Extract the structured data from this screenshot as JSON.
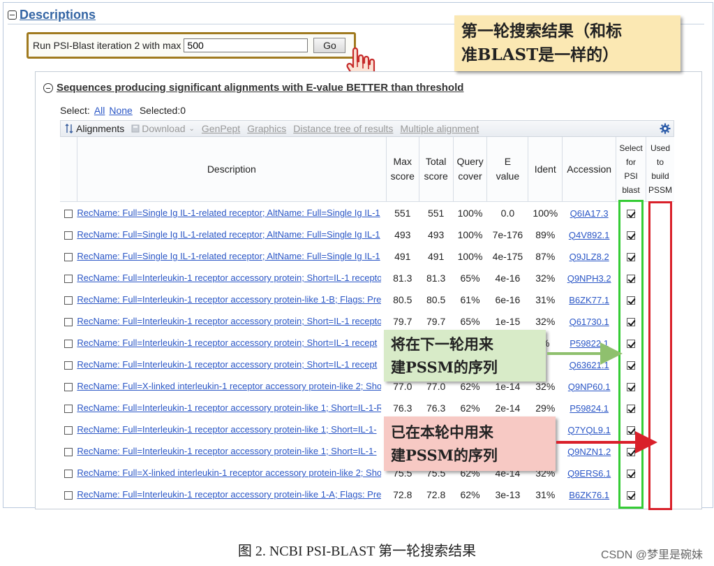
{
  "descriptions": {
    "title": "Descriptions"
  },
  "psi": {
    "label": "Run PSI-Blast iteration 2 with max",
    "value": "500",
    "go_label": "Go"
  },
  "section": {
    "title": "Sequences producing significant alignments with E-value BETTER than threshold"
  },
  "select": {
    "label": "Select:",
    "all": "All",
    "none": "None",
    "selected": "Selected:0"
  },
  "toolbar": {
    "alignments": "Alignments",
    "download": "Download",
    "genpept": "GenPept",
    "graphics": "Graphics",
    "distance_tree": "Distance tree of results",
    "multiple_alignment": "Multiple alignment"
  },
  "table": {
    "headers": {
      "description": "Description",
      "max_score": [
        "Max",
        "score"
      ],
      "total_score": [
        "Total",
        "score"
      ],
      "query_cover": [
        "Query",
        "cover"
      ],
      "e_value": [
        "E",
        "value"
      ],
      "ident": "Ident",
      "accession": "Accession",
      "select_psi": [
        "Select",
        "for",
        "PSI",
        "blast"
      ],
      "used_pssm": [
        "Used",
        "to",
        "build",
        "PSSM"
      ]
    },
    "rows": [
      {
        "desc": "RecName: Full=Single Ig IL-1-related receptor; AltName: Full=Single Ig IL-1",
        "max": "551",
        "total": "551",
        "cover": "100%",
        "e": "0.0",
        "ident": "100%",
        "acc": "Q6IA17.3"
      },
      {
        "desc": "RecName: Full=Single Ig IL-1-related receptor; AltName: Full=Single Ig IL-1",
        "max": "493",
        "total": "493",
        "cover": "100%",
        "e": "7e-176",
        "ident": "89%",
        "acc": "Q4V892.1"
      },
      {
        "desc": "RecName: Full=Single Ig IL-1-related receptor; AltName: Full=Single Ig IL-1",
        "max": "491",
        "total": "491",
        "cover": "100%",
        "e": "4e-175",
        "ident": "87%",
        "acc": "Q9JLZ8.2"
      },
      {
        "desc": "RecName: Full=Interleukin-1 receptor accessory protein; Short=IL-1 recepto",
        "max": "81.3",
        "total": "81.3",
        "cover": "65%",
        "e": "4e-16",
        "ident": "32%",
        "acc": "Q9NPH3.2"
      },
      {
        "desc": "RecName: Full=Interleukin-1 receptor accessory protein-like 1-B; Flags: Pre",
        "max": "80.5",
        "total": "80.5",
        "cover": "61%",
        "e": "6e-16",
        "ident": "31%",
        "acc": "B6ZK77.1"
      },
      {
        "desc": "RecName: Full=Interleukin-1 receptor accessory protein; Short=IL-1 recepto",
        "max": "79.7",
        "total": "79.7",
        "cover": "65%",
        "e": "1e-15",
        "ident": "32%",
        "acc": "Q61730.1"
      },
      {
        "desc": "RecName: Full=Interleukin-1 receptor accessory protein; Short=IL-1 recept",
        "max": "",
        "total": "",
        "cover": "",
        "e": "",
        "ident": "%",
        "acc": "P59822.1"
      },
      {
        "desc": "RecName: Full=Interleukin-1 receptor accessory protein; Short=IL-1 recept",
        "max": "",
        "total": "",
        "cover": "",
        "e": "",
        "ident": "",
        "acc": "Q63621.1"
      },
      {
        "desc": "RecName: Full=X-linked interleukin-1 receptor accessory protein-like 2; Sho",
        "max": "77.0",
        "total": "77.0",
        "cover": "62%",
        "e": "1e-14",
        "ident": "32%",
        "acc": "Q9NP60.1"
      },
      {
        "desc": "RecName: Full=Interleukin-1 receptor accessory protein-like 1; Short=IL-1-R",
        "max": "76.3",
        "total": "76.3",
        "cover": "62%",
        "e": "2e-14",
        "ident": "29%",
        "acc": "P59824.1"
      },
      {
        "desc": "RecName: Full=Interleukin-1 receptor accessory protein-like 1; Short=IL-1-",
        "max": "",
        "total": "",
        "cover": "",
        "e": "",
        "ident": "",
        "acc": "Q7YQL9.1"
      },
      {
        "desc": "RecName: Full=Interleukin-1 receptor accessory protein-like 1; Short=IL-1-",
        "max": "",
        "total": "",
        "cover": "",
        "e": "",
        "ident": "",
        "acc": "Q9NZN1.2"
      },
      {
        "desc": "RecName: Full=X-linked interleukin-1 receptor accessory protein-like 2; Sho",
        "max": "75.5",
        "total": "75.5",
        "cover": "62%",
        "e": "4e-14",
        "ident": "32%",
        "acc": "Q9ERS6.1"
      },
      {
        "desc": "RecName: Full=Interleukin-1 receptor accessory protein-like 1-A; Flags: Pre",
        "max": "72.8",
        "total": "72.8",
        "cover": "62%",
        "e": "3e-13",
        "ident": "31%",
        "acc": "B6ZK76.1"
      }
    ]
  },
  "annotations": {
    "yellow": [
      "第一轮搜索结果（和标",
      "准BLAST是一样的）"
    ],
    "green": [
      "将在下一轮用来",
      "建PSSM的序列"
    ],
    "pink": [
      "已在本轮中用来",
      "建PSSM的序列"
    ]
  },
  "caption": "图 2. NCBI PSI-BLAST 第一轮搜索结果",
  "watermark": "CSDN @梦里是碗妹",
  "colors": {
    "link": "#2a56c6",
    "green_frame": "#35cc35",
    "red_frame": "#d9202a",
    "highlight_box": "#a07a1f"
  }
}
